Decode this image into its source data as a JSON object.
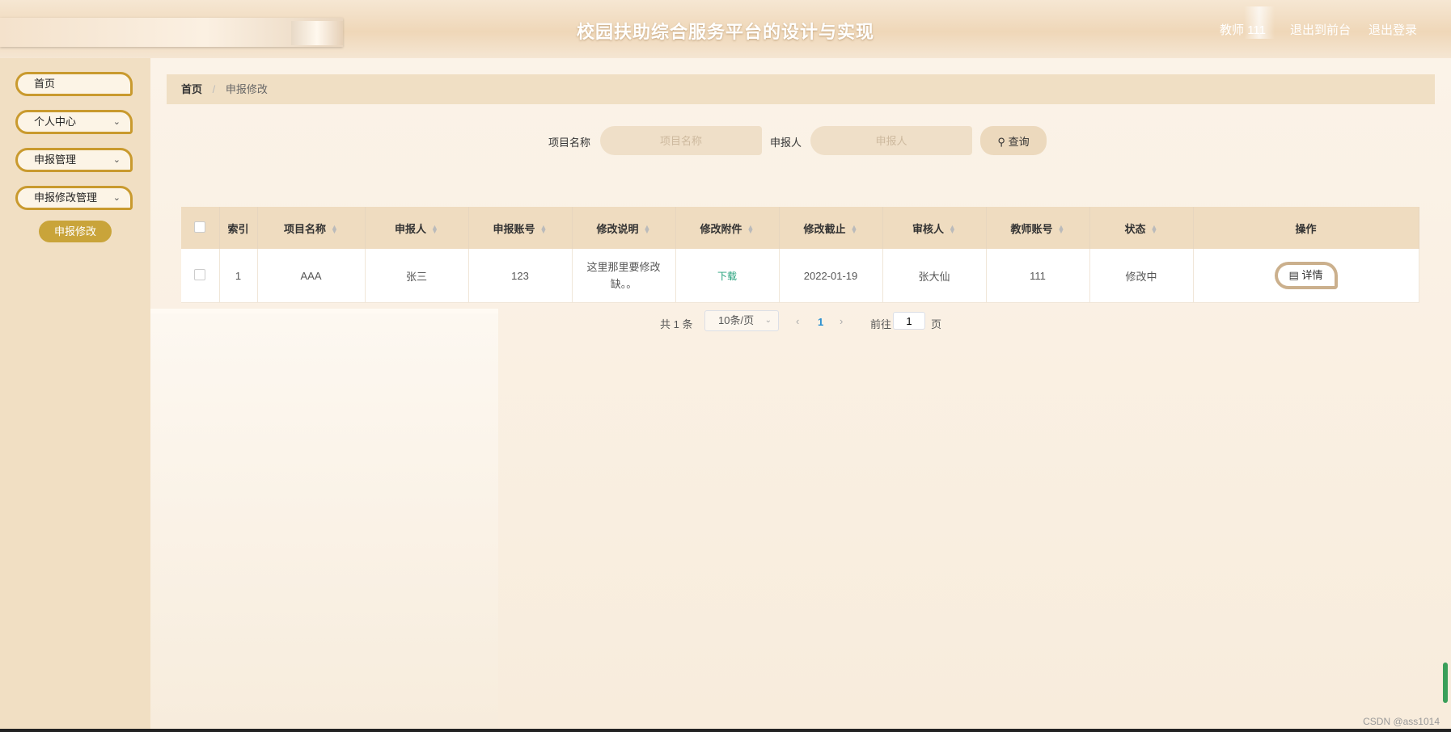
{
  "header": {
    "title": "校园扶助综合服务平台的设计与实现",
    "user": "教师 111",
    "to_front": "退出到前台",
    "logout": "退出登录"
  },
  "sidebar": {
    "items": [
      {
        "label": "首页"
      },
      {
        "label": "个人中心"
      },
      {
        "label": "申报管理"
      },
      {
        "label": "申报修改管理"
      }
    ],
    "sub_item": "申报修改"
  },
  "breadcrumb": {
    "home": "首页",
    "separator": "/",
    "current": "申报修改"
  },
  "search": {
    "project_label": "项目名称",
    "project_placeholder": "项目名称",
    "applicant_label": "申报人",
    "applicant_placeholder": "申报人",
    "button": "查询"
  },
  "table": {
    "headers": [
      "索引",
      "项目名称",
      "申报人",
      "申报账号",
      "修改说明",
      "修改附件",
      "修改截止",
      "审核人",
      "教师账号",
      "状态",
      "操作"
    ],
    "rows": [
      {
        "index": "1",
        "project": "AAA",
        "applicant": "张三",
        "account": "123",
        "note_line1": "这里那里要修改",
        "note_line2": "缺。。",
        "attachment": "下载",
        "deadline": "2022-01-19",
        "reviewer": "张大仙",
        "teacher_account": "111",
        "status": "修改中",
        "action": "详情"
      }
    ]
  },
  "pagination": {
    "total": "共 1 条",
    "page_size": "10条/页",
    "current_page": "1",
    "goto_label": "前往",
    "goto_value": "1",
    "goto_suffix": "页"
  },
  "watermark": "CSDN @ass1014",
  "colors": {
    "accent": "#c99a2e",
    "sidebar_bg": "#f1dfc3",
    "header_th": "#efdcc0",
    "download": "#22a07a"
  }
}
